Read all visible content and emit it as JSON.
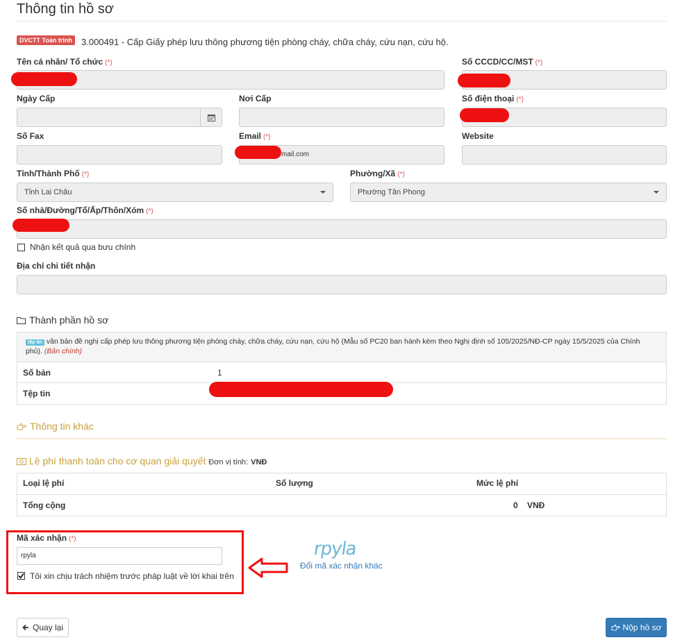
{
  "header": {
    "title": "Thông tin hồ sơ"
  },
  "procedure": {
    "badge": "DVCTT Toàn trình",
    "name": "3.000491 - Cấp Giấy phép lưu thông phương tiện phòng cháy, chữa cháy, cứu nạn, cứu hộ."
  },
  "form": {
    "name_label": "Tên cá nhân/ Tổ chức",
    "id_label": "Số CCCD/CC/MST",
    "issue_date_label": "Ngày Cấp",
    "issue_place_label": "Nơi Cấp",
    "phone_label": "Số điện thoại",
    "fax_label": "Số Fax",
    "email_label": "Email",
    "email_value": "mail.com",
    "website_label": "Website",
    "province_label": "Tỉnh/Thành Phố",
    "province_value": "Tỉnh Lai Châu",
    "ward_label": "Phường/Xã",
    "ward_value": "Phường Tân Phong",
    "address_label": "Số nhà/Đường/Tổ/Ấp/Thôn/Xóm",
    "postal_label": "Nhận kết quả qua bưu chính",
    "detail_address_label": "Địa chỉ chi tiết nhận",
    "required_mark": "(*)"
  },
  "documents": {
    "section_title": "Thành phần hồ sơ",
    "file_badge": "tệp tin",
    "doc_text": "văn bản đề nghị cấp phép lưu thông phương tiện phòng cháy, chữa cháy, cứu nạn, cứu hộ (Mẫu số PC20 ban hành kèm theo Nghị định số 105/2025/NĐ-CP ngày 15/5/2025 của Chính phủ).",
    "doc_note": "(Bản chính)",
    "copies_label": "Số bản",
    "copies_value": "1",
    "file_label": "Tệp tin"
  },
  "other": {
    "section_title": "Thông tin khác"
  },
  "fees": {
    "section_title": "Lệ phí thanh toán cho cơ quan giải quyết",
    "unit_label": "Đơn vị tính:",
    "unit_value": "VNĐ",
    "col_type": "Loại lệ phí",
    "col_qty": "Số lượng",
    "col_fee": "Mức lệ phí",
    "total_label": "Tổng cộng",
    "total_value": "0",
    "total_currency": "VNĐ"
  },
  "captcha": {
    "label": "Mã xác nhận",
    "value": "rpyla",
    "image_text": "rpyla",
    "refresh_link": "Đổi mã xác nhận khác",
    "agree_label": "Tôi xin chịu trách nhiệm trước pháp luật về lời khai trên"
  },
  "actions": {
    "back_label": "Quay lại",
    "submit_label": "Nộp hồ sơ"
  },
  "colors": {
    "accent": "#337ab7",
    "danger": "#d9534f",
    "gold": "#c9a13b",
    "annotation_red": "#e11"
  }
}
